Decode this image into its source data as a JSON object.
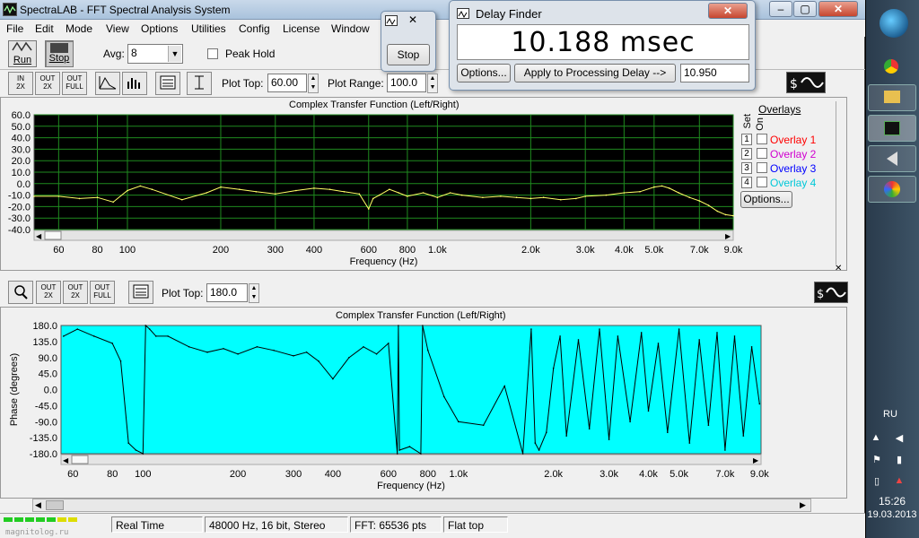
{
  "window": {
    "title": "SpectraLAB - FFT Spectral Analysis System",
    "controls": [
      "–",
      "▢",
      "✕"
    ]
  },
  "menu": [
    "File",
    "Edit",
    "Mode",
    "View",
    "Options",
    "Utilities",
    "Config",
    "License",
    "Window"
  ],
  "toolbar": {
    "run_label": "Run",
    "stop_label": "Stop",
    "avg_label": "Avg:",
    "avg_value": "8",
    "peak_hold_label": "Peak Hold"
  },
  "stop_popup": {
    "button": "Stop",
    "close": "✕"
  },
  "delay_finder": {
    "title": "Delay Finder",
    "reading": "10.188 msec",
    "options_button": "Options...",
    "apply_button": "Apply to Processing Delay -->",
    "delay_value": "10.950",
    "close": "✕"
  },
  "top_panel": {
    "buttons": [
      [
        "IN",
        "1",
        "2X"
      ],
      [
        "OUT",
        "1",
        "2X"
      ],
      [
        "OUT",
        "1",
        "FULL"
      ]
    ],
    "plot_top_label": "Plot Top:",
    "plot_top_value": "60.00",
    "plot_range_label": "Plot Range:",
    "plot_range_value": "100.0",
    "overlays": {
      "title": "Overlays",
      "set_label": "Set",
      "on_label": "On",
      "items": [
        {
          "num": "1",
          "label": "Overlay 1",
          "color": "#ff0000"
        },
        {
          "num": "2",
          "label": "Overlay 2",
          "color": "#d000d0"
        },
        {
          "num": "3",
          "label": "Overlay 3",
          "color": "#0000ff"
        },
        {
          "num": "4",
          "label": "Overlay 4",
          "color": "#00c8d8"
        }
      ],
      "options_button": "Options..."
    }
  },
  "bottom_panel": {
    "buttons": [
      [
        "OUT",
        "1",
        "2X"
      ],
      [
        "OUT",
        "1",
        "2X"
      ],
      [
        "OUT",
        "1",
        "FULL"
      ]
    ],
    "plot_top_label": "Plot Top:",
    "plot_top_value": "180.0"
  },
  "chart_data": [
    {
      "type": "line",
      "title": "Complex Transfer Function (Left/Right)",
      "xlabel": "Frequency (Hz)",
      "ylabel": "",
      "x_scale": "log",
      "xlim": [
        50,
        9000
      ],
      "ylim": [
        -40,
        60
      ],
      "x_ticks": [
        60,
        80,
        100,
        200,
        300,
        400,
        600,
        800,
        1000,
        2000,
        3000,
        4000,
        5000,
        7000,
        9000
      ],
      "x_tick_labels": [
        "60",
        "80",
        "100",
        "200",
        "300",
        "400",
        "600",
        "800",
        "1.0k",
        "2.0k",
        "3.0k",
        "4.0k",
        "5.0k",
        "7.0k",
        "9.0k"
      ],
      "y_ticks": [
        60,
        50,
        40,
        30,
        20,
        10,
        0,
        -10,
        -20,
        -30,
        -40
      ],
      "y_tick_labels": [
        "60.0",
        "50.0",
        "40.0",
        "30.0",
        "20.0",
        "10.0",
        "0.0",
        "-10.0",
        "-20.0",
        "-30.0",
        "-40.0"
      ],
      "grid": true,
      "background": "#000000",
      "grid_color": "#1f8a1f",
      "line_color": "#ffff66",
      "series": [
        {
          "x": [
            50,
            60,
            70,
            80,
            90,
            100,
            110,
            120,
            150,
            180,
            200,
            230,
            260,
            300,
            350,
            400,
            450,
            500,
            560,
            600,
            620,
            650,
            700,
            750,
            800,
            900,
            1000,
            1100,
            1200,
            1400,
            1600,
            1800,
            2000,
            2200,
            2500,
            2800,
            3000,
            3500,
            4000,
            4500,
            5000,
            5300,
            5600,
            6000,
            6500,
            7000,
            7500,
            8000,
            8500,
            9000
          ],
          "y": [
            -11,
            -11,
            -13,
            -12,
            -16,
            -6,
            -2,
            -5,
            -14,
            -8,
            -3,
            -5,
            -7,
            -9,
            -6,
            -4,
            -5,
            -7,
            -9,
            -22,
            -13,
            -10,
            -5,
            -8,
            -11,
            -8,
            -12,
            -8,
            -10,
            -12,
            -11,
            -12,
            -13,
            -12,
            -14,
            -13,
            -11,
            -10,
            -8,
            -7,
            -3,
            -2,
            -4,
            -8,
            -12,
            -15,
            -19,
            -24,
            -27,
            -28
          ]
        }
      ]
    },
    {
      "type": "line",
      "title": "Complex Transfer Function (Left/Right)",
      "xlabel": "Frequency (Hz)",
      "ylabel": "Phase (degrees)",
      "x_scale": "log",
      "xlim": [
        55,
        9100
      ],
      "ylim": [
        -180,
        180
      ],
      "x_ticks": [
        60,
        80,
        100,
        200,
        300,
        400,
        600,
        800,
        1000,
        2000,
        3000,
        4000,
        5000,
        7000,
        9000
      ],
      "x_tick_labels": [
        "60",
        "80",
        "100",
        "200",
        "300",
        "400",
        "600",
        "800",
        "1.0k",
        "2.0k",
        "3.0k",
        "4.0k",
        "5.0k",
        "7.0k",
        "9.0k"
      ],
      "y_ticks": [
        180,
        135,
        90,
        45,
        0,
        -45,
        -90,
        -135,
        -180
      ],
      "y_tick_labels": [
        "180.0",
        "135.0",
        "90.0",
        "45.0",
        "0.0",
        "-45.0",
        "-90.0",
        "-135.0",
        "-180.0"
      ],
      "grid": false,
      "background": "#00ffff",
      "line_color": "#000000",
      "series": [
        {
          "x": [
            56,
            62,
            70,
            80,
            85,
            90,
            95,
            100,
            102,
            105,
            110,
            120,
            140,
            160,
            180,
            200,
            230,
            260,
            300,
            330,
            360,
            400,
            450,
            500,
            550,
            600,
            640,
            645,
            650,
            700,
            760,
            770,
            800,
            900,
            1000,
            1200,
            1400,
            1600,
            1700,
            1750,
            1800,
            1900,
            2000,
            2100,
            2200,
            2400,
            2600,
            2800,
            3000,
            3200,
            3500,
            3800,
            4000,
            4300,
            4600,
            5000,
            5400,
            5800,
            6200,
            6600,
            7000,
            7500,
            8000,
            8500,
            9000
          ],
          "y": [
            150,
            170,
            150,
            130,
            80,
            -150,
            -170,
            -180,
            180,
            170,
            150,
            150,
            120,
            105,
            115,
            100,
            120,
            110,
            95,
            105,
            80,
            30,
            90,
            120,
            100,
            130,
            -180,
            180,
            -170,
            -160,
            -180,
            180,
            110,
            -20,
            -90,
            -100,
            10,
            -180,
            170,
            -150,
            -170,
            -120,
            60,
            150,
            -130,
            140,
            -110,
            170,
            -140,
            150,
            -90,
            160,
            -60,
            130,
            -120,
            170,
            -150,
            140,
            -100,
            160,
            -170,
            150,
            -130,
            120,
            -40
          ]
        }
      ]
    }
  ],
  "status": {
    "level": "",
    "mode": "Real Time",
    "format": "48000 Hz, 16 bit, Stereo",
    "fft": "FFT: 65536 pts",
    "window": "Flat top"
  },
  "taskbar": {
    "lang": "RU",
    "time": "15:26",
    "date": "19.03.2013"
  },
  "watermark": "magnitolog.ru"
}
